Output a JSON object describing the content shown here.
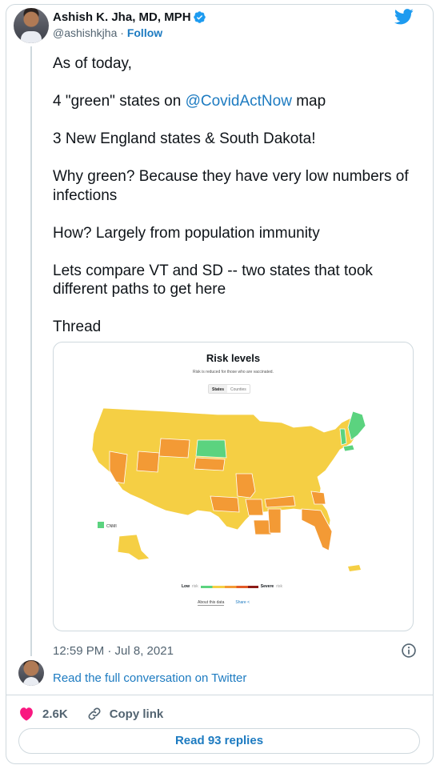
{
  "author": {
    "name": "Ashish K. Jha, MD, MPH",
    "handle": "@ashishkjha",
    "separator": "·",
    "follow_label": "Follow"
  },
  "icons": {
    "brand": "twitter-bird-icon",
    "verified": "verified-badge-icon",
    "info": "info-icon",
    "like": "heart-icon",
    "copy": "link-icon"
  },
  "colors": {
    "link": "#1d7bc1",
    "like": "#f91880",
    "green_state": "#5bd37f",
    "yellow_state": "#f5cf44",
    "orange_state": "#f39a35"
  },
  "tweet": {
    "line1": "As of today,",
    "line2_before": "4 \"green\" states  on ",
    "line2_mention": "@CovidActNow",
    "line2_after": " map",
    "line3": "3 New England states & South Dakota!",
    "line4": "Why green? Because they have very low numbers of infections",
    "line5": "How? Largely from population immunity",
    "line6": "Lets compare VT and SD -- two states that took different paths to get here",
    "line7": "Thread"
  },
  "media": {
    "title": "Risk levels",
    "subtitle": "Risk is reduced for those who are vaccinated.",
    "toggle_states": "States",
    "toggle_counties": "Counties",
    "territory_label": "CNMI",
    "legend_low": "Low",
    "legend_low_suffix": "risk",
    "legend_severe": "Severe",
    "legend_severe_suffix": "risk",
    "about_link": "About this data",
    "share_link": "Share"
  },
  "meta": {
    "timestamp": "12:59 PM · Jul 8, 2021"
  },
  "conversation_link": "Read the full conversation on Twitter",
  "actions": {
    "likes": "2.6K",
    "copy_link": "Copy link"
  },
  "replies_button": "Read 93 replies"
}
